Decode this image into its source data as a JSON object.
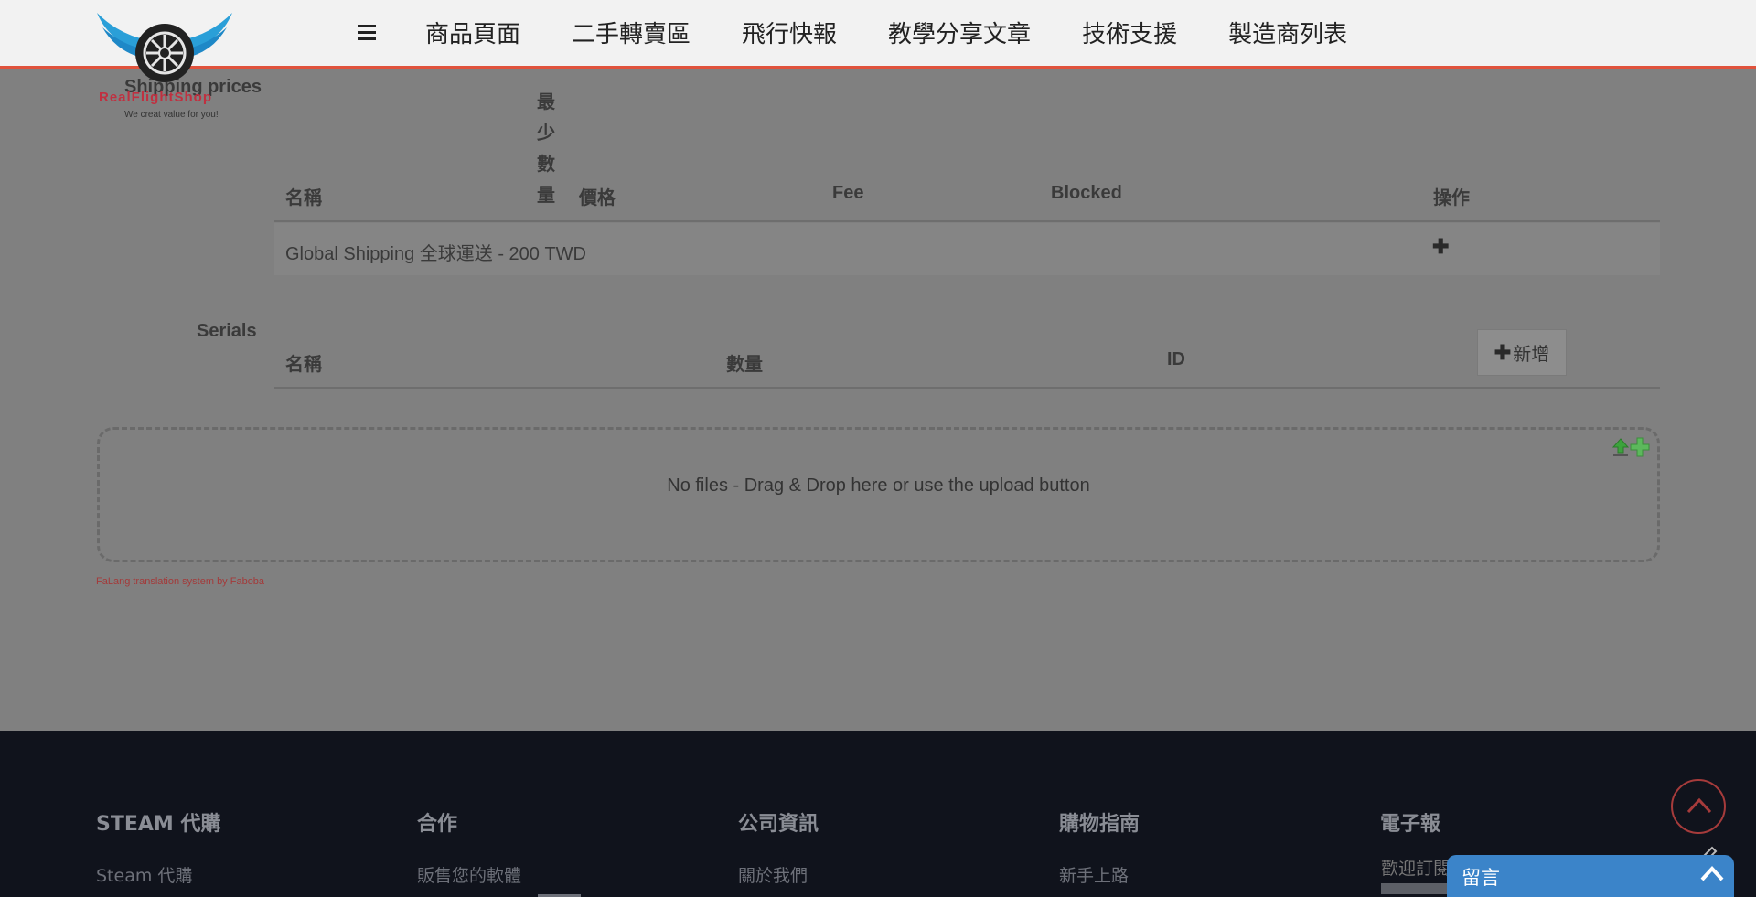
{
  "header": {
    "nav": [
      "商品頁面",
      "二手轉賣區",
      "飛行快報",
      "教學分享文章",
      "技術支援",
      "製造商列表"
    ]
  },
  "logo": {
    "brand_text": "RealFlightShop",
    "tagline": "We creat value for you!"
  },
  "shipping": {
    "title": "Shipping prices",
    "columns": {
      "name": "名稱",
      "min_qty_chars": [
        "最",
        "少",
        "數",
        "量"
      ],
      "price": "價格",
      "fee": "Fee",
      "blocked": "Blocked",
      "actions": "操作"
    },
    "rows": [
      {
        "name": "Global Shipping 全球運送 - 200 TWD"
      }
    ]
  },
  "serials": {
    "title": "Serials",
    "columns": {
      "name": "名稱",
      "quantity": "數量",
      "id": "ID"
    },
    "add_label": "新增"
  },
  "dropzone": {
    "text": "No files - Drag & Drop here or use the upload button"
  },
  "credit": "FaLang translation system by Faboba",
  "footer": {
    "columns": [
      {
        "heading": "STEAM 代購",
        "link": "Steam 代購"
      },
      {
        "heading": "合作",
        "link": "販售您的軟體"
      },
      {
        "heading": "公司資訊",
        "link": "關於我們"
      },
      {
        "heading": "購物指南",
        "link": "新手上路"
      },
      {
        "heading": "電子報",
        "link": ""
      }
    ],
    "newsletter_placeholder": "歡迎訂閱"
  },
  "chat": {
    "label": "留言"
  },
  "colors": {
    "accent": "#e0533d",
    "chat": "#3b84c9",
    "footer_bg": "#10131c",
    "overlay": "#808080"
  }
}
